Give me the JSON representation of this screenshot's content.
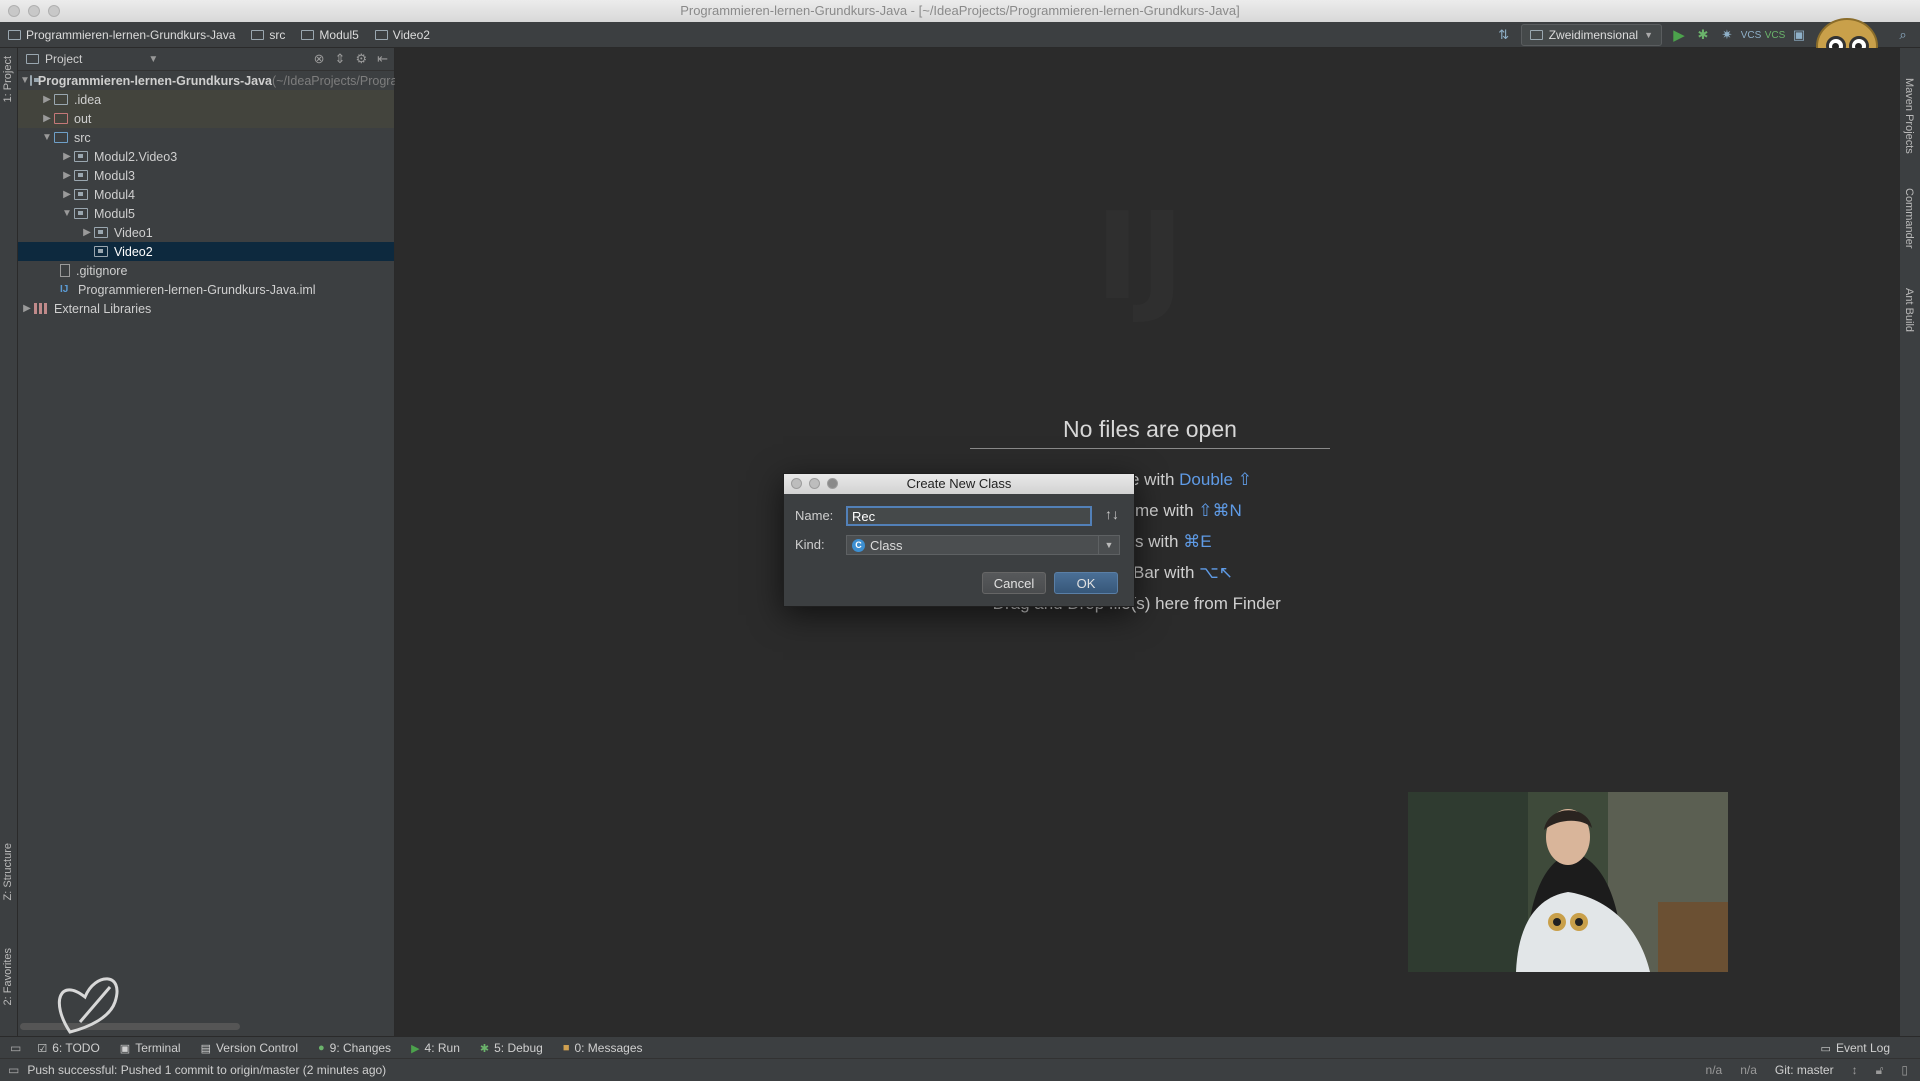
{
  "window": {
    "title": "Programmieren-lernen-Grundkurs-Java - [~/IdeaProjects/Programmieren-lernen-Grundkurs-Java]"
  },
  "breadcrumb": [
    {
      "label": "Programmieren-lernen-Grundkurs-Java"
    },
    {
      "label": "src"
    },
    {
      "label": "Modul5"
    },
    {
      "label": "Video2"
    }
  ],
  "toolbar": {
    "run_config": "Zweidimensional"
  },
  "left_stripe": {
    "project_tab": "1: Project",
    "structure_tab": "Z: Structure",
    "favorites_tab": "2: Favorites"
  },
  "right_stripe": {
    "maven_tab": "Maven Projects",
    "commander_tab": "Commander",
    "ant_tab": "Ant Build"
  },
  "project_panel": {
    "header": "Project",
    "tree": [
      {
        "label": "Programmieren-lernen-Grundkurs-Java",
        "suffix": " (~/IdeaProjects/Programmieren-lernen-Grundkurs-Java)"
      },
      {
        "label": ".idea"
      },
      {
        "label": "out"
      },
      {
        "label": "src"
      },
      {
        "label": "Modul2.Video3"
      },
      {
        "label": "Modul3"
      },
      {
        "label": "Modul4"
      },
      {
        "label": "Modul5"
      },
      {
        "label": "Video1"
      },
      {
        "label": "Video2"
      },
      {
        "label": ".gitignore"
      },
      {
        "label": "Programmieren-lernen-Grundkurs-Java.iml"
      },
      {
        "label": "External Libraries"
      }
    ]
  },
  "editor": {
    "empty_title": "No files are open",
    "hints": [
      {
        "text": "e with ",
        "key": "Double ⇧"
      },
      {
        "text": "me with ",
        "key": "⇧⌘N"
      },
      {
        "text": "s with ",
        "key": "⌘E"
      },
      {
        "text": "Bar with ",
        "key": "⌥↖"
      },
      {
        "text": "• Drag and Drop file(s) here from Finder",
        "key": ""
      }
    ]
  },
  "dialog": {
    "title": "Create New Class",
    "name_label": "Name:",
    "name_value": "Rec",
    "kind_label": "Kind:",
    "kind_value": "Class",
    "kind_icon_letter": "C",
    "cancel_label": "Cancel",
    "ok_label": "OK"
  },
  "tool_windows": [
    {
      "label": "6: TODO"
    },
    {
      "label": "Terminal"
    },
    {
      "label": "Version Control"
    },
    {
      "label": "9: Changes"
    },
    {
      "label": "4: Run"
    },
    {
      "label": "5: Debug"
    },
    {
      "label": "0: Messages"
    }
  ],
  "event_log": "Event Log",
  "status": {
    "message": "Push successful: Pushed 1 commit to origin/master (2 minutes ago)",
    "pos1": "n/a",
    "pos2": "n/a",
    "git": "Git: master"
  },
  "colors": {
    "background": "#2b2b2b",
    "panel": "#3c3f41",
    "selection": "#0d293e",
    "accent": "#5f9be6"
  }
}
